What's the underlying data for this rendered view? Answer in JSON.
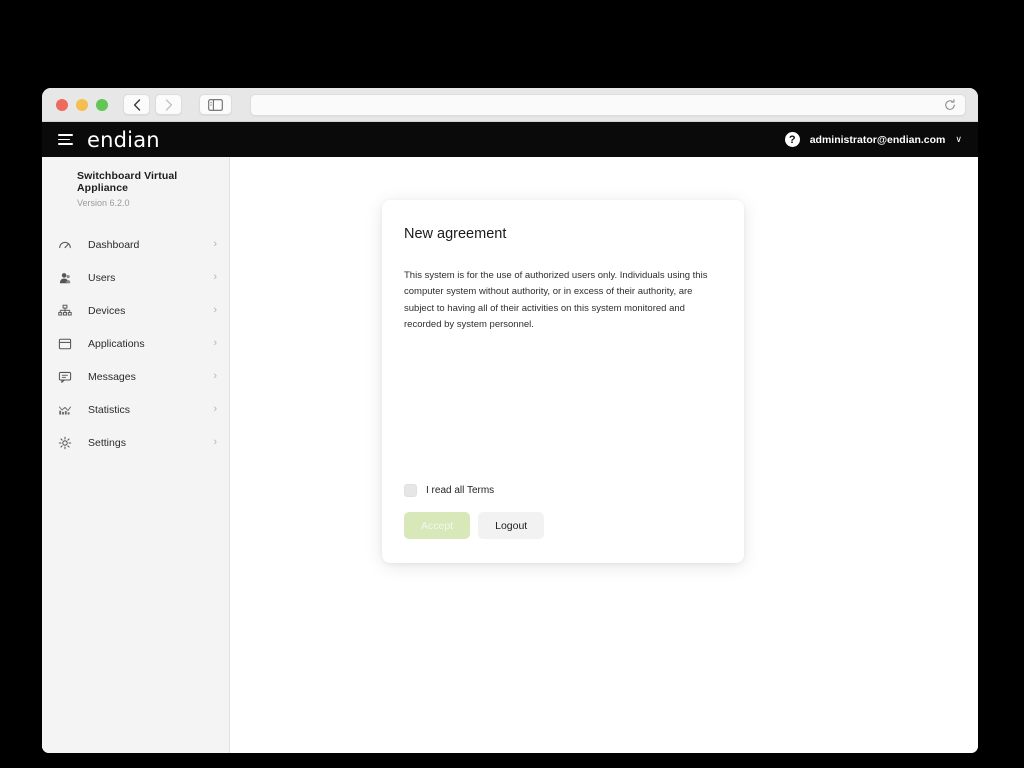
{
  "browser": {
    "traffic_lights": [
      "close",
      "minimize",
      "maximize"
    ],
    "back_label": "back-arrow-icon",
    "forward_label": "forward-arrow-icon",
    "sidebar_toggle_label": "sidebar-toggle-icon",
    "reload_label": "reload-icon",
    "url_value": "",
    "url_placeholder": ""
  },
  "header": {
    "menu_label": "hamburger-icon",
    "brand": "endian",
    "help_label": "?",
    "user_email": "administrator@endian.com",
    "caret": "∨"
  },
  "sidebar": {
    "appliance_name": "Switchboard Virtual Appliance",
    "version": "Version 6.2.0",
    "chevron": "›",
    "items": [
      {
        "label": "Dashboard",
        "icon": "gauge-icon"
      },
      {
        "label": "Users",
        "icon": "user-icon"
      },
      {
        "label": "Devices",
        "icon": "network-icon"
      },
      {
        "label": "Applications",
        "icon": "window-icon"
      },
      {
        "label": "Messages",
        "icon": "chat-icon"
      },
      {
        "label": "Statistics",
        "icon": "bar-chart-icon"
      },
      {
        "label": "Settings",
        "icon": "gear-icon"
      }
    ]
  },
  "dialog": {
    "title": "New agreement",
    "body": "This system is for the use of authorized users only. Individuals using this computer system without authority, or in excess of their authority, are subject to having all of their activities on this system monitored and recorded by system personnel.",
    "checkbox_label": "I read all Terms",
    "checkbox_checked": false,
    "accept_label": "Accept",
    "accept_disabled": true,
    "logout_label": "Logout"
  },
  "colors": {
    "header_bg": "#0a0a0a",
    "sidebar_bg": "#f4f4f4",
    "accept_bg": "#d8e8b8",
    "logout_bg": "#f2f2f2",
    "page_bg": "#000000"
  }
}
